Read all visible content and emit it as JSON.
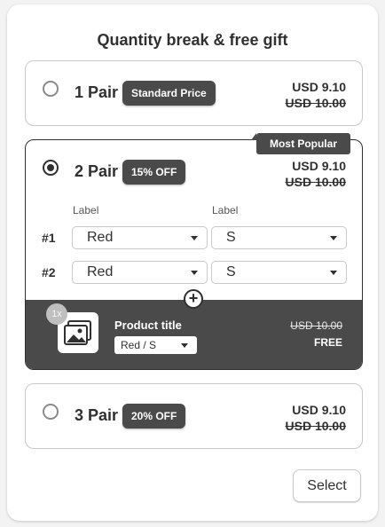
{
  "title": "Quantity break & free gift",
  "options": [
    {
      "qty": "1 Pair",
      "badge": "Standard Price",
      "price": "USD 9.10",
      "old_price": "USD 10.00",
      "selected": false
    },
    {
      "qty": "2 Pair",
      "badge": "15% OFF",
      "price": "USD 9.10",
      "old_price": "USD 10.00",
      "selected": true,
      "ribbon": "Most Popular"
    },
    {
      "qty": "3 Pair",
      "badge": "20% OFF",
      "price": "USD 9.10",
      "old_price": "USD 10.00",
      "selected": false
    }
  ],
  "variant_labels": [
    "Label",
    "Label"
  ],
  "rows": [
    {
      "num": "#1",
      "color": "Red",
      "size": "S"
    },
    {
      "num": "#2",
      "color": "Red",
      "size": "S"
    }
  ],
  "gift": {
    "count": "1x",
    "product_title": "Product title",
    "variant": "Red / S",
    "old_price": "USD 10.00",
    "price": "FREE"
  },
  "select_button": "Select",
  "colors": {
    "dark": "#4a4a4a",
    "text": "#303030",
    "border": "#c9c9c9"
  }
}
